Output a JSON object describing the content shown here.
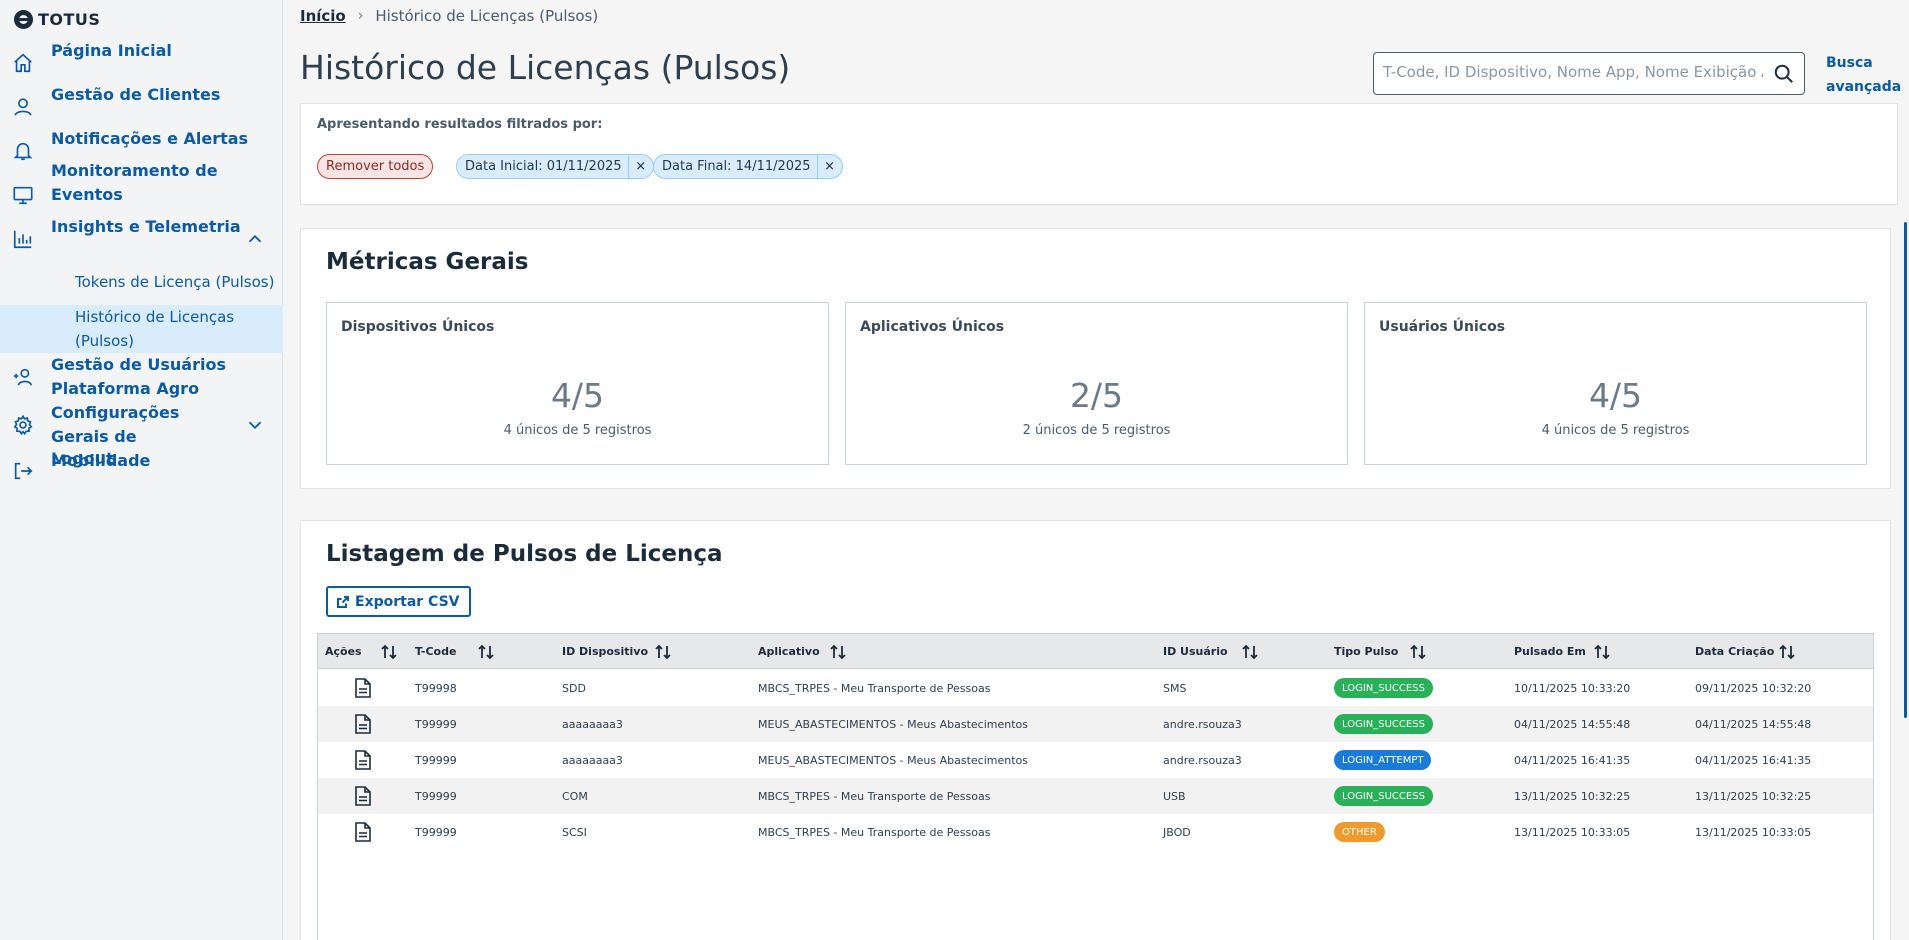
{
  "brand": {
    "name": "TOTUS"
  },
  "sidebar": {
    "items": [
      {
        "label": "Página Inicial",
        "icon": "home-icon"
      },
      {
        "label": "Gestão de Clientes",
        "icon": "user-icon"
      },
      {
        "label": "Notificações e Alertas",
        "icon": "bell-icon"
      },
      {
        "label": "Monitoramento de Eventos",
        "icon": "monitor-icon"
      },
      {
        "label": "Insights e Telemetria",
        "icon": "bar-chart-icon",
        "expanded": true
      },
      {
        "label": "Gestão de Usuários Plataforma Agro",
        "icon": "user-plus-icon"
      },
      {
        "label": "Configurações Gerais de Mobilidade",
        "icon": "gear-icon",
        "expanded": false
      },
      {
        "label": "Logout",
        "icon": "logout-icon"
      }
    ],
    "subitems": [
      {
        "label": "Tokens de Licença (Pulsos)",
        "active": false
      },
      {
        "label": "Histórico de Licenças (Pulsos)",
        "active": true
      }
    ]
  },
  "breadcrumb": {
    "home": "Início",
    "current": "Histórico de Licenças (Pulsos)"
  },
  "page": {
    "title": "Histórico de Licenças (Pulsos)"
  },
  "search": {
    "placeholder": "T-Code, ID Dispositivo, Nome App, Nome Exibição App",
    "advanced_label": "Busca avançada"
  },
  "filters": {
    "heading": "Apresentando resultados filtrados por:",
    "remove_all": "Remover todos",
    "chips": [
      "Data Inicial: 01/11/2025",
      "Data Final: 14/11/2025"
    ],
    "close_glyph": "×"
  },
  "metrics": {
    "title": "Métricas Gerais",
    "cards": [
      {
        "label": "Dispositivos Únicos",
        "value": "4/5",
        "sub": "4 únicos de 5 registros"
      },
      {
        "label": "Aplicativos Únicos",
        "value": "2/5",
        "sub": "2 únicos de 5 registros"
      },
      {
        "label": "Usuários Únicos",
        "value": "4/5",
        "sub": "4 únicos de 5 registros"
      }
    ]
  },
  "listing": {
    "title": "Listagem de Pulsos de Licença",
    "export_label": "Exportar CSV",
    "columns": [
      "Ações",
      "T-Code",
      "ID Dispositivo",
      "Aplicativo",
      "ID Usuário",
      "Tipo Pulso",
      "Pulsado Em",
      "Data Criação"
    ],
    "rows": [
      {
        "tcode": "T99998",
        "device": "SDD",
        "app": "MBCS_TRPES - Meu Transporte de Pessoas",
        "user": "SMS",
        "type": "LOGIN_SUCCESS",
        "type_class": "success",
        "pulsed": "10/11/2025 10:33:20",
        "created": "09/11/2025 10:32:20"
      },
      {
        "tcode": "T99999",
        "device": "aaaaaaaa3",
        "app": "MEUS_ABASTECIMENTOS - Meus Abastecimentos",
        "user": "andre.rsouza3",
        "type": "LOGIN_SUCCESS",
        "type_class": "success",
        "pulsed": "04/11/2025 14:55:48",
        "created": "04/11/2025 14:55:48"
      },
      {
        "tcode": "T99999",
        "device": "aaaaaaaa3",
        "app": "MEUS_ABASTECIMENTOS - Meus Abastecimentos",
        "user": "andre.rsouza3",
        "type": "LOGIN_ATTEMPT",
        "type_class": "attempt",
        "pulsed": "04/11/2025 16:41:35",
        "created": "04/11/2025 16:41:35"
      },
      {
        "tcode": "T99999",
        "device": "COM",
        "app": "MBCS_TRPES - Meu Transporte de Pessoas",
        "user": "USB",
        "type": "LOGIN_SUCCESS",
        "type_class": "success",
        "pulsed": "13/11/2025 10:32:25",
        "created": "13/11/2025 10:32:25"
      },
      {
        "tcode": "T99999",
        "device": "SCSI",
        "app": "MBCS_TRPES - Meu Transporte de Pessoas",
        "user": "JBOD",
        "type": "OTHER",
        "type_class": "other",
        "pulsed": "13/11/2025 10:33:05",
        "created": "13/11/2025 10:33:05"
      }
    ]
  }
}
